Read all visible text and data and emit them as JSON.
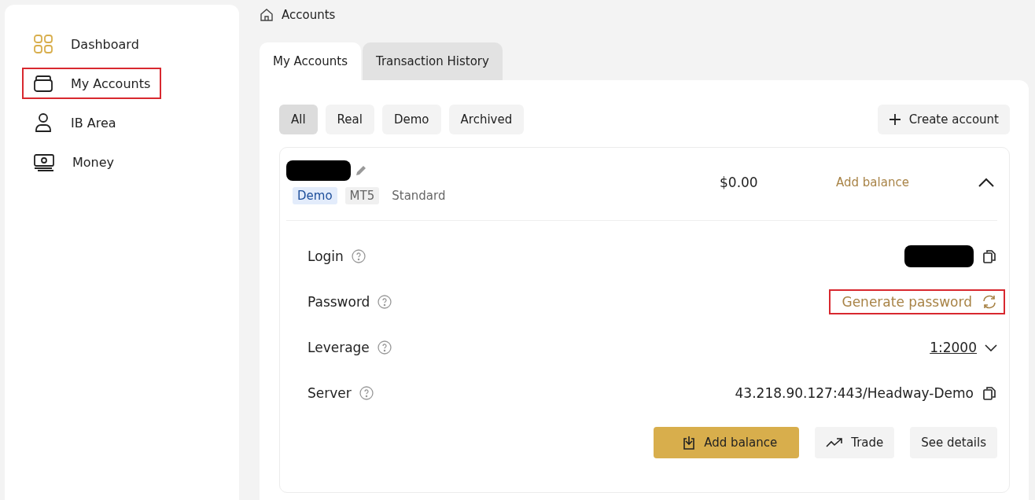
{
  "sidebar": {
    "items": [
      {
        "label": "Dashboard",
        "selected": true,
        "highlighted": false
      },
      {
        "label": "My Accounts",
        "selected": false,
        "highlighted": true
      },
      {
        "label": "IB Area",
        "selected": false,
        "highlighted": false
      },
      {
        "label": "Money",
        "selected": false,
        "highlighted": false
      }
    ]
  },
  "breadcrumb": {
    "label": "Accounts"
  },
  "tabs": [
    {
      "label": "My Accounts",
      "selected": true
    },
    {
      "label": "Transaction History",
      "selected": false
    }
  ],
  "filters": [
    {
      "label": "All",
      "selected": true
    },
    {
      "label": "Real",
      "selected": false
    },
    {
      "label": "Demo",
      "selected": false
    },
    {
      "label": "Archived",
      "selected": false
    }
  ],
  "create_button": {
    "label": "Create account"
  },
  "account": {
    "expanded": true,
    "tags": [
      {
        "label": "Demo",
        "kind": "type"
      },
      {
        "label": "MT5",
        "kind": "platform"
      },
      {
        "label": "Standard",
        "kind": "plain"
      }
    ],
    "balance": "$0.00",
    "add_balance_link": "Add balance",
    "details": [
      {
        "label": "Login",
        "kind": "redacted",
        "highlighted": false
      },
      {
        "label": "Password",
        "kind": "action",
        "value": "Generate password",
        "highlighted": true
      },
      {
        "label": "Leverage",
        "kind": "select",
        "value": "1:2000",
        "highlighted": false
      },
      {
        "label": "Server",
        "kind": "copy",
        "value": "43.218.90.127:443/Headway-Demo",
        "highlighted": false
      }
    ],
    "buttons": [
      {
        "label": "Add balance",
        "kind": "primary"
      },
      {
        "label": "Trade",
        "kind": "trade"
      },
      {
        "label": "See details",
        "kind": "plain"
      }
    ]
  }
}
